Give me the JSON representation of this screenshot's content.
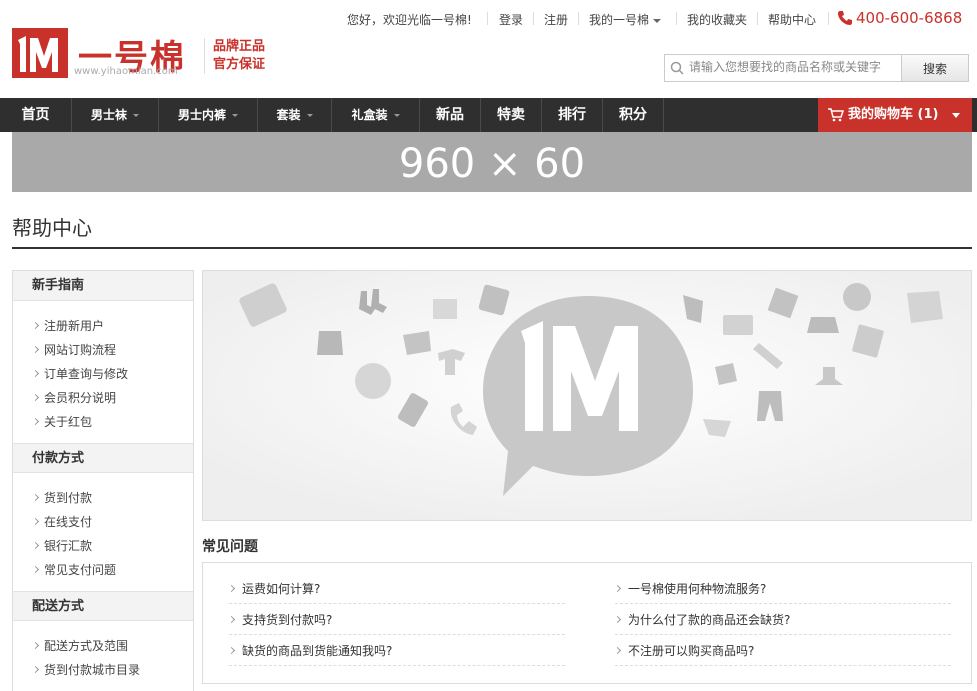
{
  "top": {
    "welcome": "您好，欢迎光临一号棉!",
    "login": "登录",
    "register": "注册",
    "my_account": "我的一号棉",
    "favorites": "我的收藏夹",
    "help": "帮助中心",
    "phone": "400-600-6868"
  },
  "logo": {
    "name": "一号棉",
    "url": "www.yihaomian.com",
    "slogan_line1": "品牌正品",
    "slogan_line2": "官方保证"
  },
  "search": {
    "placeholder": "请输入您想要找的商品名称或关键字",
    "button": "搜索"
  },
  "nav": {
    "items": [
      {
        "label": "首页",
        "dropdown": false
      },
      {
        "label": "男士袜",
        "dropdown": true
      },
      {
        "label": "男士内裤",
        "dropdown": true
      },
      {
        "label": "套装",
        "dropdown": true
      },
      {
        "label": "礼盒装",
        "dropdown": true
      },
      {
        "label": "新品",
        "dropdown": false
      },
      {
        "label": "特卖",
        "dropdown": false
      },
      {
        "label": "排行",
        "dropdown": false
      },
      {
        "label": "积分",
        "dropdown": false
      }
    ],
    "cart": "我的购物车 (1)"
  },
  "banner": "960 × 60",
  "page_title": "帮助中心",
  "sidebar": [
    {
      "heading": "新手指南",
      "links": [
        "注册新用户",
        "网站订购流程",
        "订单查询与修改",
        "会员积分说明",
        "关于红包"
      ]
    },
    {
      "heading": "付款方式",
      "links": [
        "货到付款",
        "在线支付",
        "银行汇款",
        "常见支付问题"
      ]
    },
    {
      "heading": "配送方式",
      "links": [
        "配送方式及范围",
        "货到付款城市目录"
      ]
    }
  ],
  "faq": {
    "title": "常见问题",
    "left": [
      "运费如何计算?",
      "支持货到付款吗?",
      "缺货的商品到货能通知我吗?"
    ],
    "right": [
      "一号棉使用何种物流服务?",
      "为什么付了款的商品还会缺货?",
      "不注册可以购买商品吗?"
    ]
  },
  "colors": {
    "brand_red": "#c9312b",
    "nav_bg": "#2f2f2f",
    "banner_bg": "#a9a9a9"
  }
}
